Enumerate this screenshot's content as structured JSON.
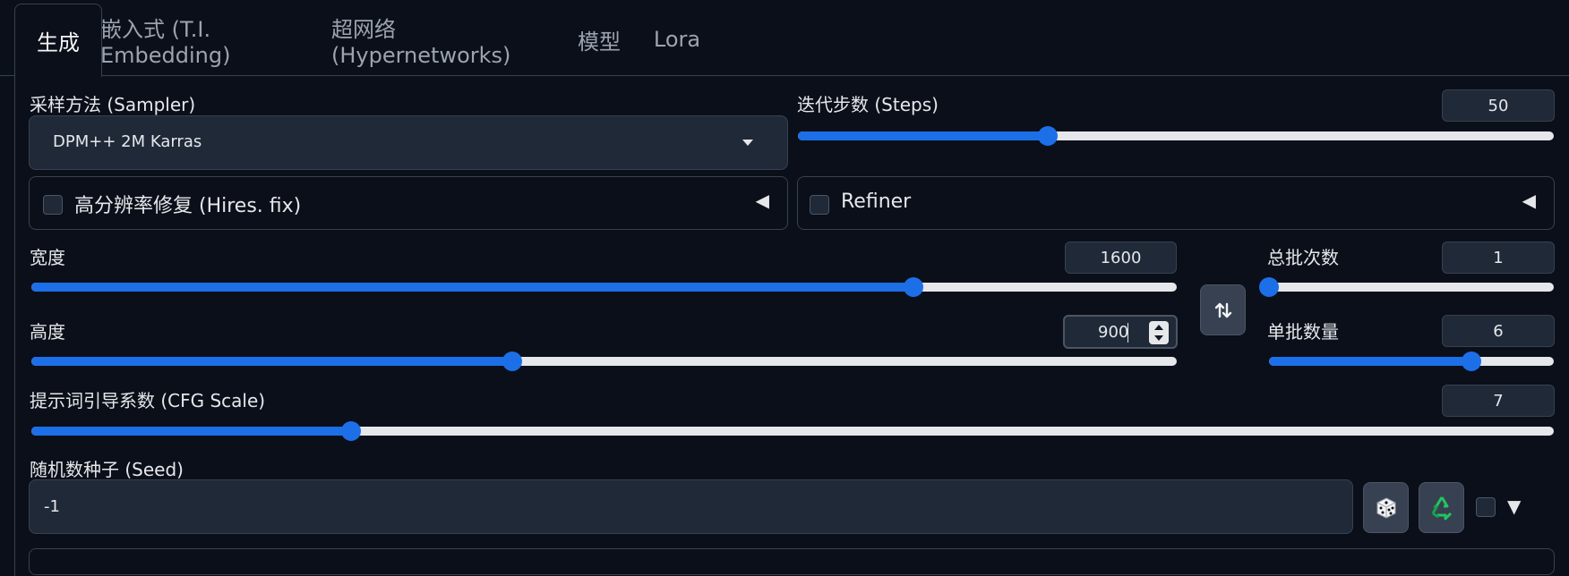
{
  "tabs": [
    {
      "label": "生成"
    },
    {
      "label": "嵌入式 (T.I. Embedding)"
    },
    {
      "label": "超网络 (Hypernetworks)"
    },
    {
      "label": "模型"
    },
    {
      "label": "Lora"
    }
  ],
  "sampler": {
    "label": "采样方法 (Sampler)",
    "value": "DPM++ 2M Karras"
  },
  "steps": {
    "label": "迭代步数 (Steps)",
    "value": "50",
    "fraction": 0.33
  },
  "hires": {
    "label": "高分辨率修复 (Hires. fix)",
    "arrow": "◀"
  },
  "refiner": {
    "label": "Refiner",
    "arrow": "◀"
  },
  "width": {
    "label": "宽度",
    "value": "1600",
    "fraction": 0.77
  },
  "height": {
    "label": "高度",
    "value": "900",
    "fraction": 0.42
  },
  "batch_count": {
    "label": "总批次数",
    "value": "1",
    "fraction": 0.0
  },
  "batch_size": {
    "label": "单批数量",
    "value": "6",
    "fraction": 0.71
  },
  "cfg": {
    "label": "提示词引导系数 (CFG Scale)",
    "value": "7",
    "fraction": 0.21
  },
  "seed": {
    "label": "随机数种子 (Seed)",
    "value": "-1",
    "expand_arrow": "▼"
  },
  "icons": {
    "swap": "swap-icon",
    "dice": "dice-icon",
    "recycle": "recycle-icon",
    "dropdown": "dropdown-arrow-icon"
  },
  "colors": {
    "accent": "#1d6fe8",
    "background": "#0b0f19",
    "input_bg": "#1f2937",
    "border": "#374151"
  }
}
